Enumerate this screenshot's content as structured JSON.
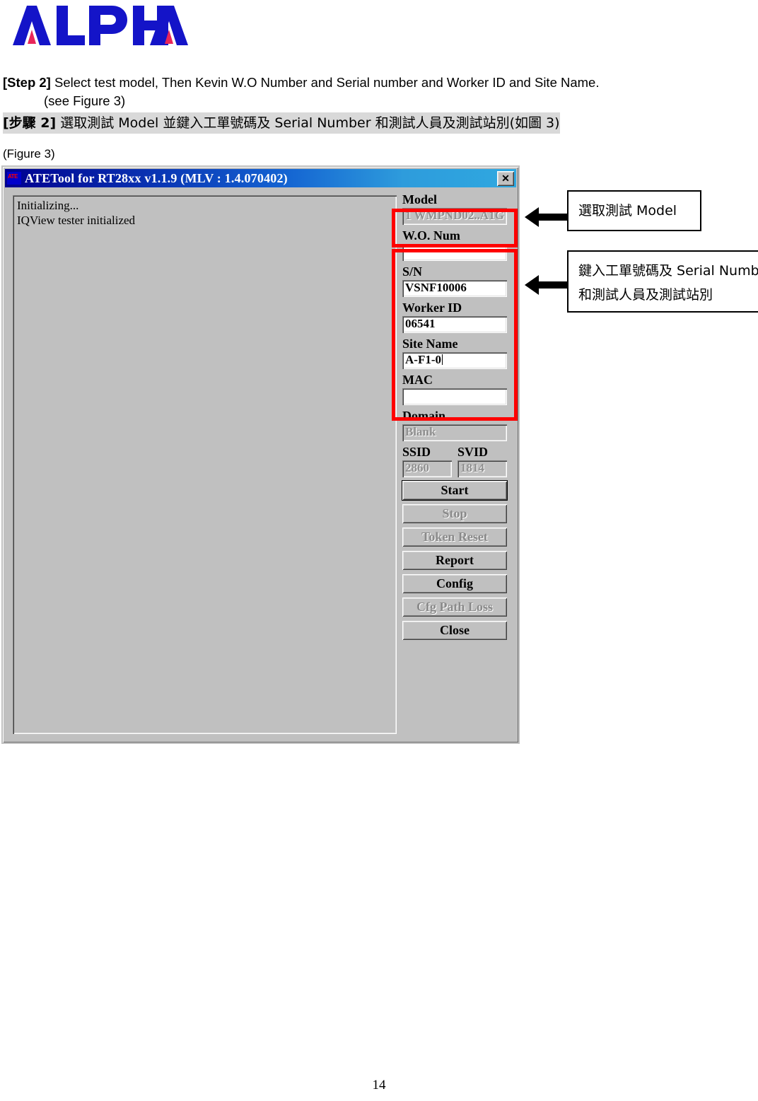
{
  "logo": {
    "text": "ALPHA",
    "blue": "#1414c8",
    "accent": "#e8265a"
  },
  "instructions": {
    "step_tag_en": "[Step 2]",
    "step_text_en": "Select test model, Then Kevin W.O Number and Serial number and Worker ID and Site Name.",
    "step_see": "(see Figure 3)",
    "step_tag_zh": "[步驟 2]",
    "step_text_zh": "選取測試 Model  並鍵入工單號碼及 Serial Number 和測試人員及測試站別(如圖 3)",
    "figure_label": "(Figure 3)"
  },
  "app": {
    "title": "ATETool for RT28xx v1.1.9 (MLV : 1.4.070402)",
    "icon_name": "ate-app-icon",
    "close_label": "✕",
    "log": [
      "Initializing...",
      "IQView tester initialized"
    ],
    "fields": [
      {
        "label": "Model",
        "value": "1 WMPND02..A1G",
        "disabled": true,
        "caret": false
      },
      {
        "label": "W.O. Num",
        "value": "",
        "disabled": false,
        "caret": false
      },
      {
        "label": "S/N",
        "value": "VSNF10006",
        "disabled": false,
        "caret": false
      },
      {
        "label": "Worker ID",
        "value": "06541",
        "disabled": false,
        "caret": false
      },
      {
        "label": "Site Name",
        "value": "A-F1-0",
        "disabled": false,
        "caret": true
      },
      {
        "label": "MAC",
        "value": "",
        "disabled": false,
        "caret": false
      },
      {
        "label": "Domain",
        "value": "Blank",
        "disabled": true,
        "caret": false
      }
    ],
    "ssid": {
      "label": "SSID",
      "value": "2860",
      "disabled": true
    },
    "svid": {
      "label": "SVID",
      "value": "1814",
      "disabled": true
    },
    "buttons": [
      {
        "label": "Start",
        "disabled": false,
        "focused": true
      },
      {
        "label": "Stop",
        "disabled": true,
        "focused": false
      },
      {
        "label": "Token Reset",
        "disabled": true,
        "focused": false
      },
      {
        "label": "Report",
        "disabled": false,
        "focused": false
      },
      {
        "label": "Config",
        "disabled": false,
        "focused": false
      },
      {
        "label": "Cfg Path Loss",
        "disabled": true,
        "focused": false
      },
      {
        "label": "Close",
        "disabled": false,
        "focused": false
      }
    ]
  },
  "annotations": {
    "highlight_color": "#ff0000",
    "callout_model": "選取測試 Model",
    "callout_fields_line1": "鍵入工單號碼及 Serial Number",
    "callout_fields_line2": "和測試人員及測試站別"
  },
  "footer": {
    "page_number": "14"
  }
}
